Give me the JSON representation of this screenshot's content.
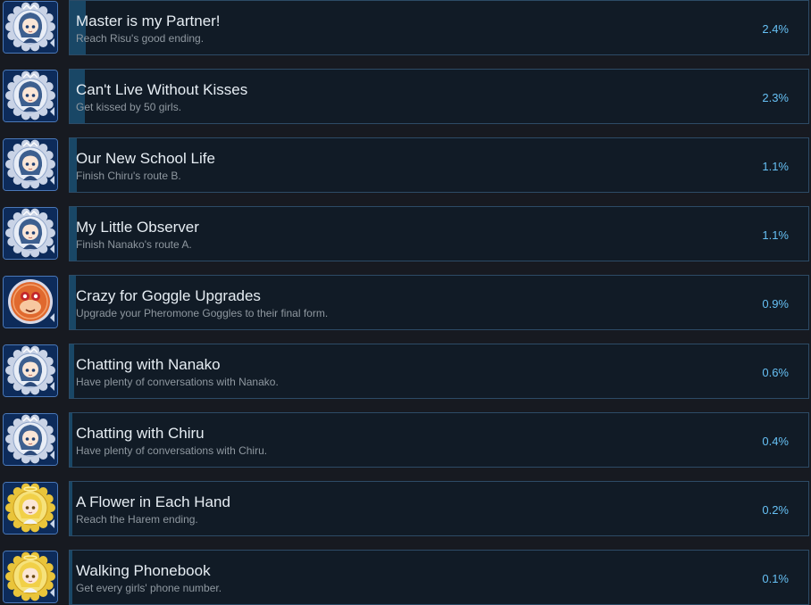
{
  "achievements": [
    {
      "title": "Master is my Partner!",
      "desc": "Reach Risu's good ending.",
      "percent": "2.4%",
      "icon": "blue-girl-medal-icon",
      "progress": 0.024
    },
    {
      "title": "Can't Live Without Kisses",
      "desc": "Get kissed by 50 girls.",
      "percent": "2.3%",
      "icon": "blue-girl-medal-icon",
      "progress": 0.023
    },
    {
      "title": "Our New School Life",
      "desc": "Finish Chiru's route B.",
      "percent": "1.1%",
      "icon": "blue-girl-medal-icon",
      "progress": 0.011
    },
    {
      "title": "My Little Observer",
      "desc": "Finish Nanako's route A.",
      "percent": "1.1%",
      "icon": "blue-girl-medal-icon",
      "progress": 0.011
    },
    {
      "title": "Crazy for Goggle Upgrades",
      "desc": "Upgrade your Pheromone Goggles to their final form.",
      "percent": "0.9%",
      "icon": "orange-goggles-medal-icon",
      "progress": 0.009
    },
    {
      "title": "Chatting with Nanako",
      "desc": "Have plenty of conversations with Nanako.",
      "percent": "0.6%",
      "icon": "blue-girl-medal-icon",
      "progress": 0.006
    },
    {
      "title": "Chatting with Chiru",
      "desc": "Have plenty of conversations with Chiru.",
      "percent": "0.4%",
      "icon": "blue-girl-medal-icon",
      "progress": 0.004
    },
    {
      "title": "A Flower in Each Hand",
      "desc": "Reach the Harem ending.",
      "percent": "0.2%",
      "icon": "gold-girl-medal-icon",
      "progress": 0.002
    },
    {
      "title": "Walking Phonebook",
      "desc": "Get every girls' phone number.",
      "percent": "0.1%",
      "icon": "gold-girl-medal-icon",
      "progress": 0.001
    }
  ],
  "colors": {
    "background": "#171a21",
    "card": "#111b26",
    "card_border": "#2d4b66",
    "progress": "#1b4f72",
    "percent": "#66c0f4",
    "title": "#e6edf3",
    "desc": "#8f98a0"
  }
}
